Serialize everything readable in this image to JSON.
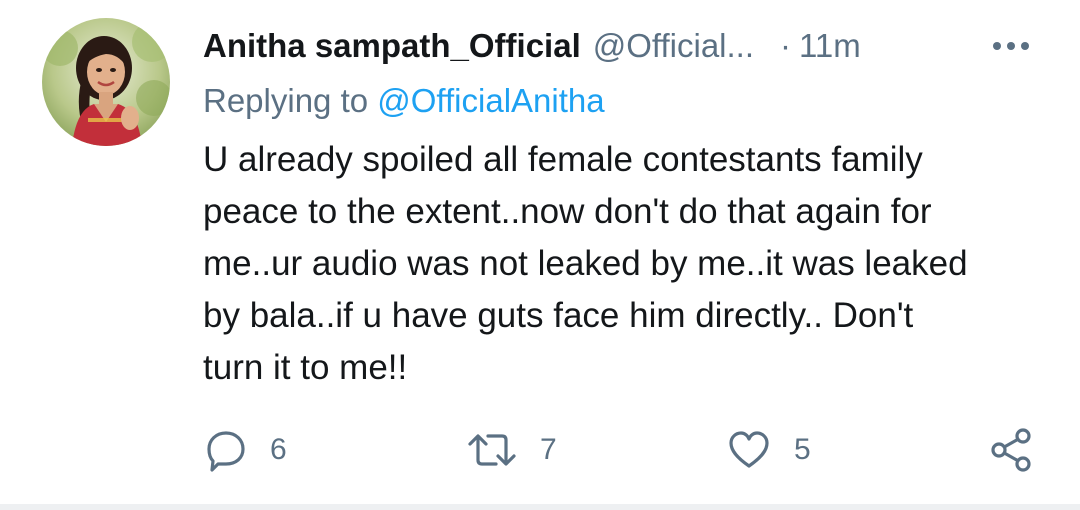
{
  "tweet": {
    "display_name": "Anitha sampath_Official",
    "handle": "@Official...",
    "separator": "·",
    "time": "11m",
    "replying_prefix": "Replying to ",
    "replying_handle": "@OfficialAnitha",
    "text": "U already spoiled all female contestants family\npeace to the extent..now don't do that again for\nme..ur audio was not leaked by me..it was leaked\nby bala..if u have guts face him directly.. Don't\nturn it to me!!"
  },
  "actions": {
    "reply_count": "6",
    "retweet_count": "7",
    "like_count": "5"
  },
  "icons": {
    "avatar": "profile-photo",
    "more": "more-dots-icon",
    "reply": "comment-bubble-icon",
    "retweet": "retweet-arrows-icon",
    "like": "heart-icon",
    "share": "share-nodes-icon"
  },
  "colors": {
    "text_primary": "#14171a",
    "text_secondary": "#5b7083",
    "mention_blue": "#1da1f2",
    "icon_gray": "#5b7083"
  }
}
